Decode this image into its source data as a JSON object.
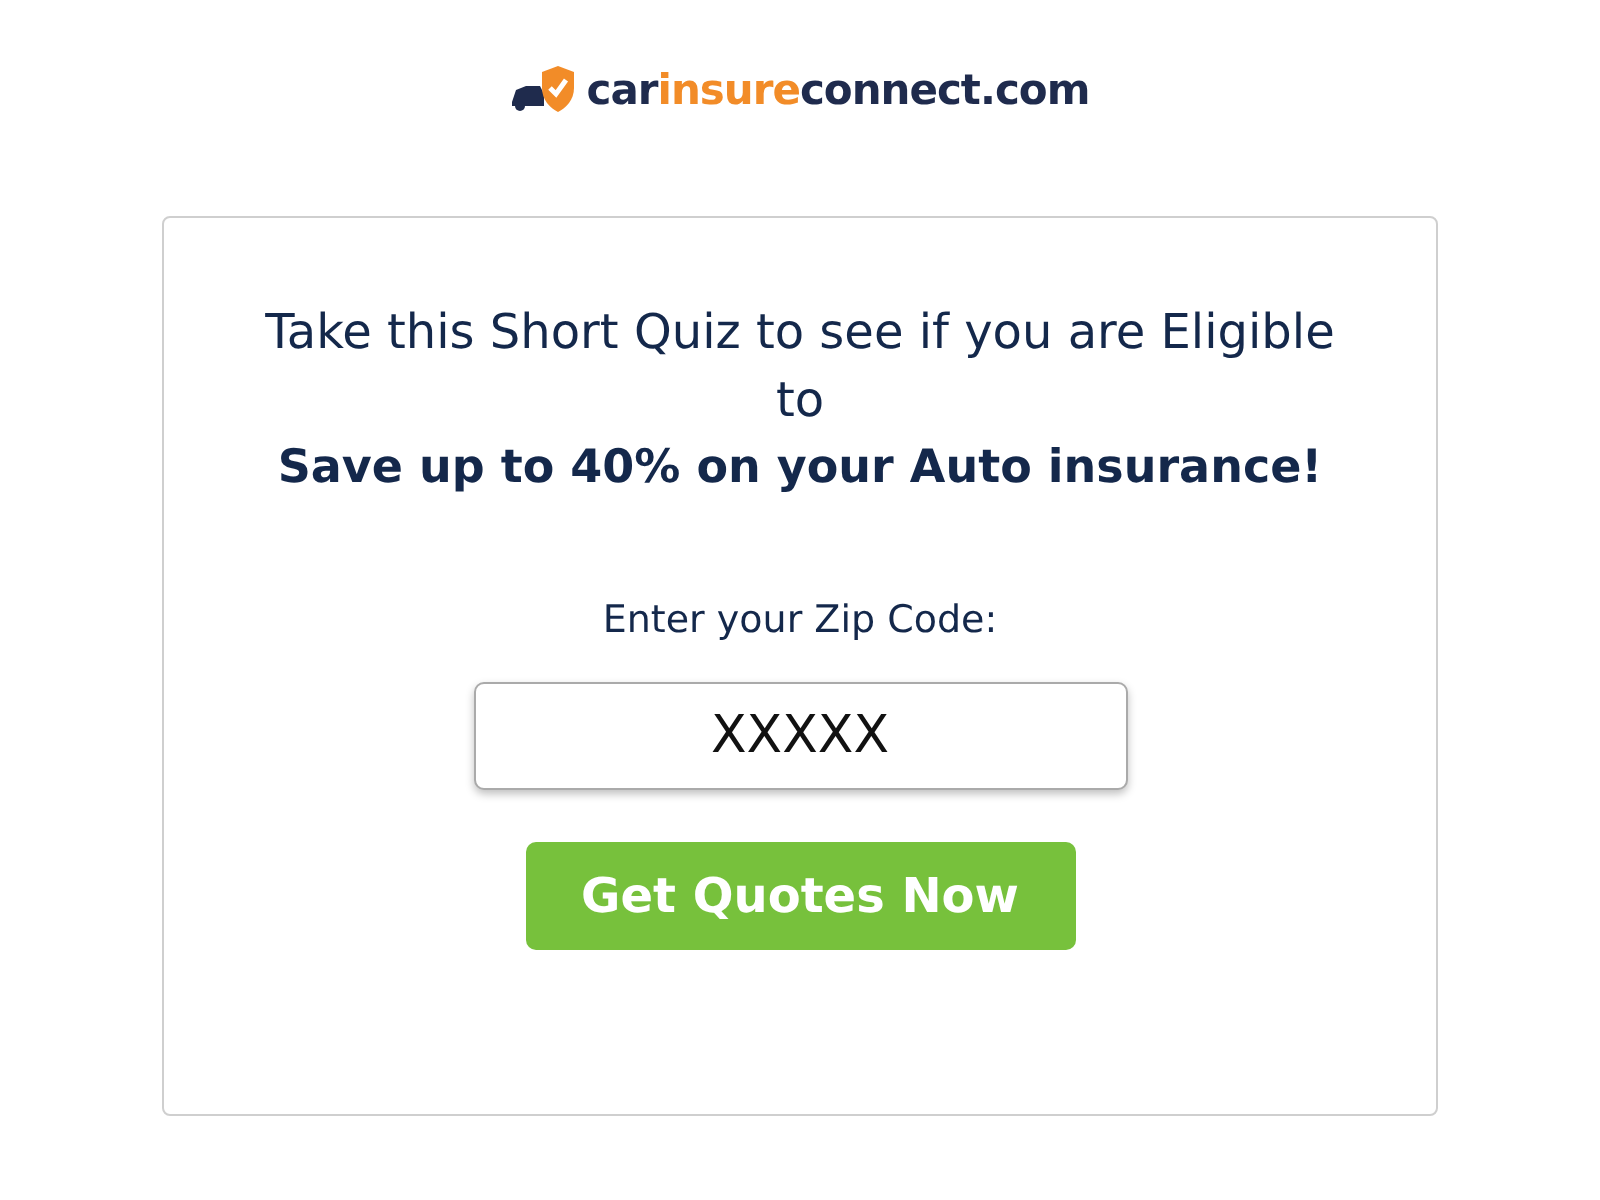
{
  "logo": {
    "parts": [
      {
        "text": "car",
        "color": "#1f2b4d"
      },
      {
        "text": "insure",
        "color": "#f28c28"
      },
      {
        "text": "connect.com",
        "color": "#1f2b4d"
      }
    ]
  },
  "card": {
    "heading": "Take this Short Quiz to see if you are Eligible to",
    "subheading": "Save up to 40% on your Auto insurance!",
    "zip_label": "Enter your Zip Code:",
    "zip_field": {
      "placeholder": "XXXXX"
    },
    "button": "Get Quotes Now"
  }
}
